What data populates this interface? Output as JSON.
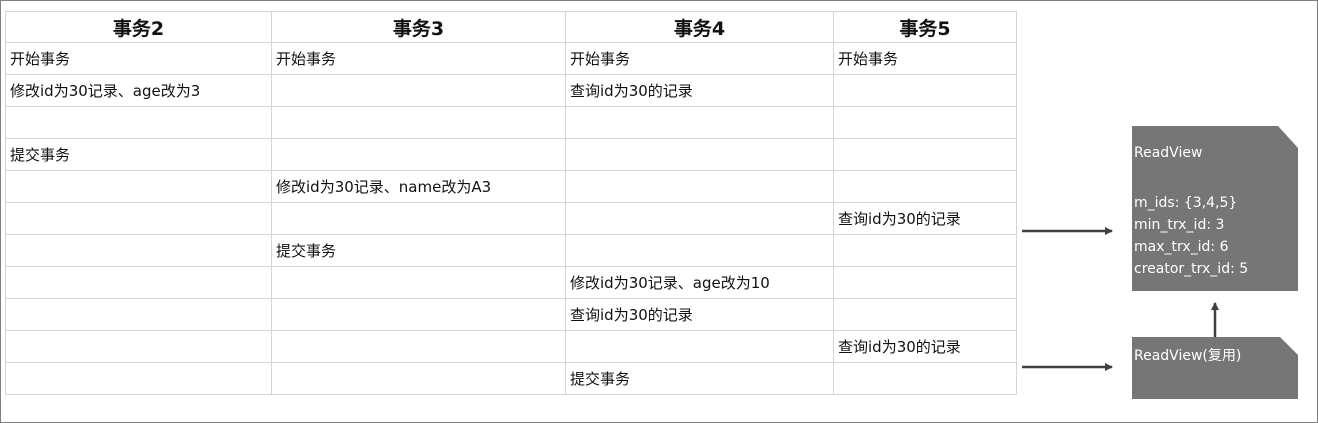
{
  "headers": [
    "事务2",
    "事务3",
    "事务4",
    "事务5"
  ],
  "rows": [
    [
      "开始事务",
      "开始事务",
      "开始事务",
      "开始事务"
    ],
    [
      "修改id为30记录、age改为3",
      "",
      "查询id为30的记录",
      ""
    ],
    [
      "",
      "",
      "",
      ""
    ],
    [
      "提交事务",
      "",
      "",
      ""
    ],
    [
      "",
      "修改id为30记录、name改为A3",
      "",
      ""
    ],
    [
      "",
      "",
      "",
      "查询id为30的记录"
    ],
    [
      "",
      "提交事务",
      "",
      ""
    ],
    [
      "",
      "",
      "修改id为30记录、age改为10",
      ""
    ],
    [
      "",
      "",
      "查询id为30的记录",
      ""
    ],
    [
      "",
      "",
      "",
      "查询id为30的记录"
    ],
    [
      "",
      "",
      "提交事务",
      ""
    ]
  ],
  "readview": {
    "title": "ReadView",
    "m_ids": "m_ids: {3,4,5}",
    "min_trx_id": "min_trx_id: 3",
    "max_trx_id": "max_trx_id: 6",
    "creator_trx_id": "creator_trx_id: 5"
  },
  "readview_reuse": {
    "title": "ReadView(复用)"
  },
  "colors": {
    "box": "#767676",
    "arrow": "#404040",
    "grid": "#d4d4d4"
  }
}
